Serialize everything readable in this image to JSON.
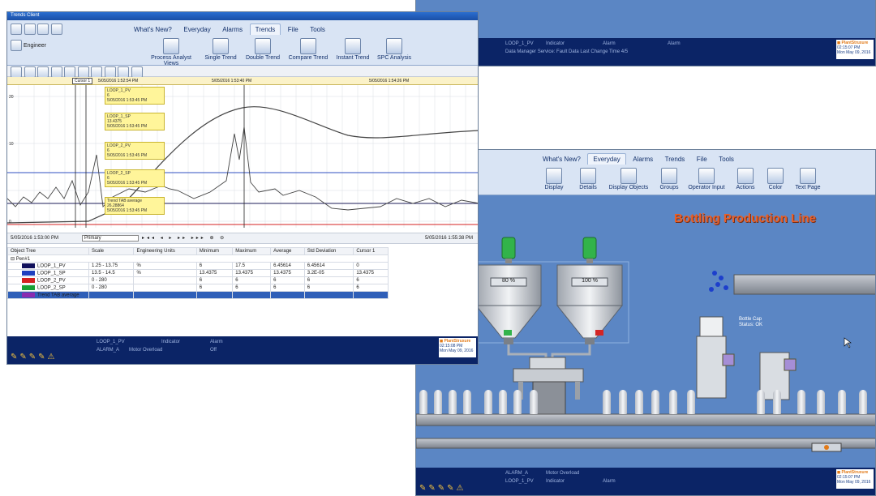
{
  "top_right_window": {
    "status": {
      "col1": "LOOP_1_PV",
      "col2": "Indicator",
      "col3": "Alarm",
      "col4": "Alarm",
      "row2": "Data Manager Service: Fault Data Last Change Time 4/5",
      "clock": "02:15:07 PM",
      "date": "Mon May 09, 2016"
    }
  },
  "trend_window": {
    "title": "Trends Client",
    "ribbon_tabs": [
      "What's New?",
      "Everyday",
      "Alarms",
      "Trends",
      "File",
      "Tools"
    ],
    "active_tab": "Trends",
    "engineer_label": "Engineer",
    "ribbon_buttons": [
      "Process Analyst Views",
      "Single Trend",
      "Double Trend",
      "Compare Trend",
      "Instant Trend",
      "SPC Analysis"
    ],
    "time_top": [
      "5/05/2016 1:52:54 PM",
      "5/05/2016 1:53:40 PM",
      "5/05/2016 1:54:26 PM"
    ],
    "cursor_label": "Cursor 1",
    "tickets": [
      {
        "tag": "LOOP_1_PV",
        "value": "6",
        "time": "5/05/2016 1:53:45 PM"
      },
      {
        "tag": "LOOP_1_SP",
        "value": "13.4375",
        "time": "5/05/2016 1:53:45 PM"
      },
      {
        "tag": "LOOP_2_PV",
        "value": "6",
        "time": "5/05/2016 1:53:45 PM"
      },
      {
        "tag": "LOOP_2_SP",
        "value": "6",
        "time": "5/05/2016 1:53:45 PM"
      },
      {
        "tag": "Trend TAB average",
        "value": "26.28864",
        "time": "5/05/2016 1:53:45 PM"
      }
    ],
    "y_ticks": [
      "20",
      "10",
      "0"
    ],
    "nav_start": "5/05/2016 1:53:00 PM",
    "nav_mode": "Primary",
    "nav_end": "5/05/2016 1:55:38 PM",
    "table": {
      "headers": [
        "Object Tree",
        "Scale",
        "Engineering Units",
        "Minimum",
        "Maximum",
        "Average",
        "Std Deviation",
        "Cursor 1"
      ],
      "group": "Pen#1",
      "rows": [
        {
          "name": "LOOP_1_PV",
          "color": "#11115c",
          "cells": [
            "1.25 - 13.75",
            "%",
            "6",
            "17.5",
            "6.45614",
            "6.45614",
            "0"
          ]
        },
        {
          "name": "LOOP_1_SP",
          "color": "#1f3fbf",
          "cells": [
            "13.5 - 14.5",
            "%",
            "13.4375",
            "13.4375",
            "13.4375",
            "3.2E-05",
            "13.4375"
          ]
        },
        {
          "name": "LOOP_2_PV",
          "color": "#d42020",
          "cells": [
            "0 - 280",
            "",
            "6",
            "6",
            "6",
            "6",
            "6"
          ]
        },
        {
          "name": "LOOP_2_SP",
          "color": "#18a035",
          "cells": [
            "0 - 280",
            "",
            "6",
            "6",
            "6",
            "6",
            "6"
          ]
        },
        {
          "name": "Trend TAB average",
          "color": "#8a2bb0",
          "cells": [
            "",
            "",
            "",
            "",
            "",
            "",
            ""
          ]
        }
      ]
    },
    "status": {
      "col1": "LOOP_1_PV",
      "col2": "Indicator",
      "col3": "Alarm",
      "row2a": "ALARM_A",
      "row2b": "Motor Overload",
      "row2c": "Off",
      "clock": "02:15:08 PM",
      "date": "Mon May 09, 2016"
    }
  },
  "bottling_window": {
    "ribbon_tabs": [
      "What's New?",
      "Everyday",
      "Alarms",
      "Trends",
      "File",
      "Tools"
    ],
    "active_tab": "Everyday",
    "ribbon_buttons": [
      "Display",
      "Details",
      "Display Objects",
      "Groups",
      "Operator Input",
      "Actions",
      "Color",
      "Text Page"
    ],
    "title": "Bottling Production Line",
    "tank1_value": "80",
    "tank2_value": "100",
    "unit": "%",
    "capper_label": "Bottle Cap",
    "capper_sub": "Status: OK",
    "status": {
      "col1": "ALARM_A",
      "col2": "Motor Overload",
      "row2a": "LOOP_1_PV",
      "row2b": "Indicator",
      "row2c": "Alarm",
      "clock": "02:15:07 PM",
      "date": "Mon May 09, 2016"
    }
  }
}
